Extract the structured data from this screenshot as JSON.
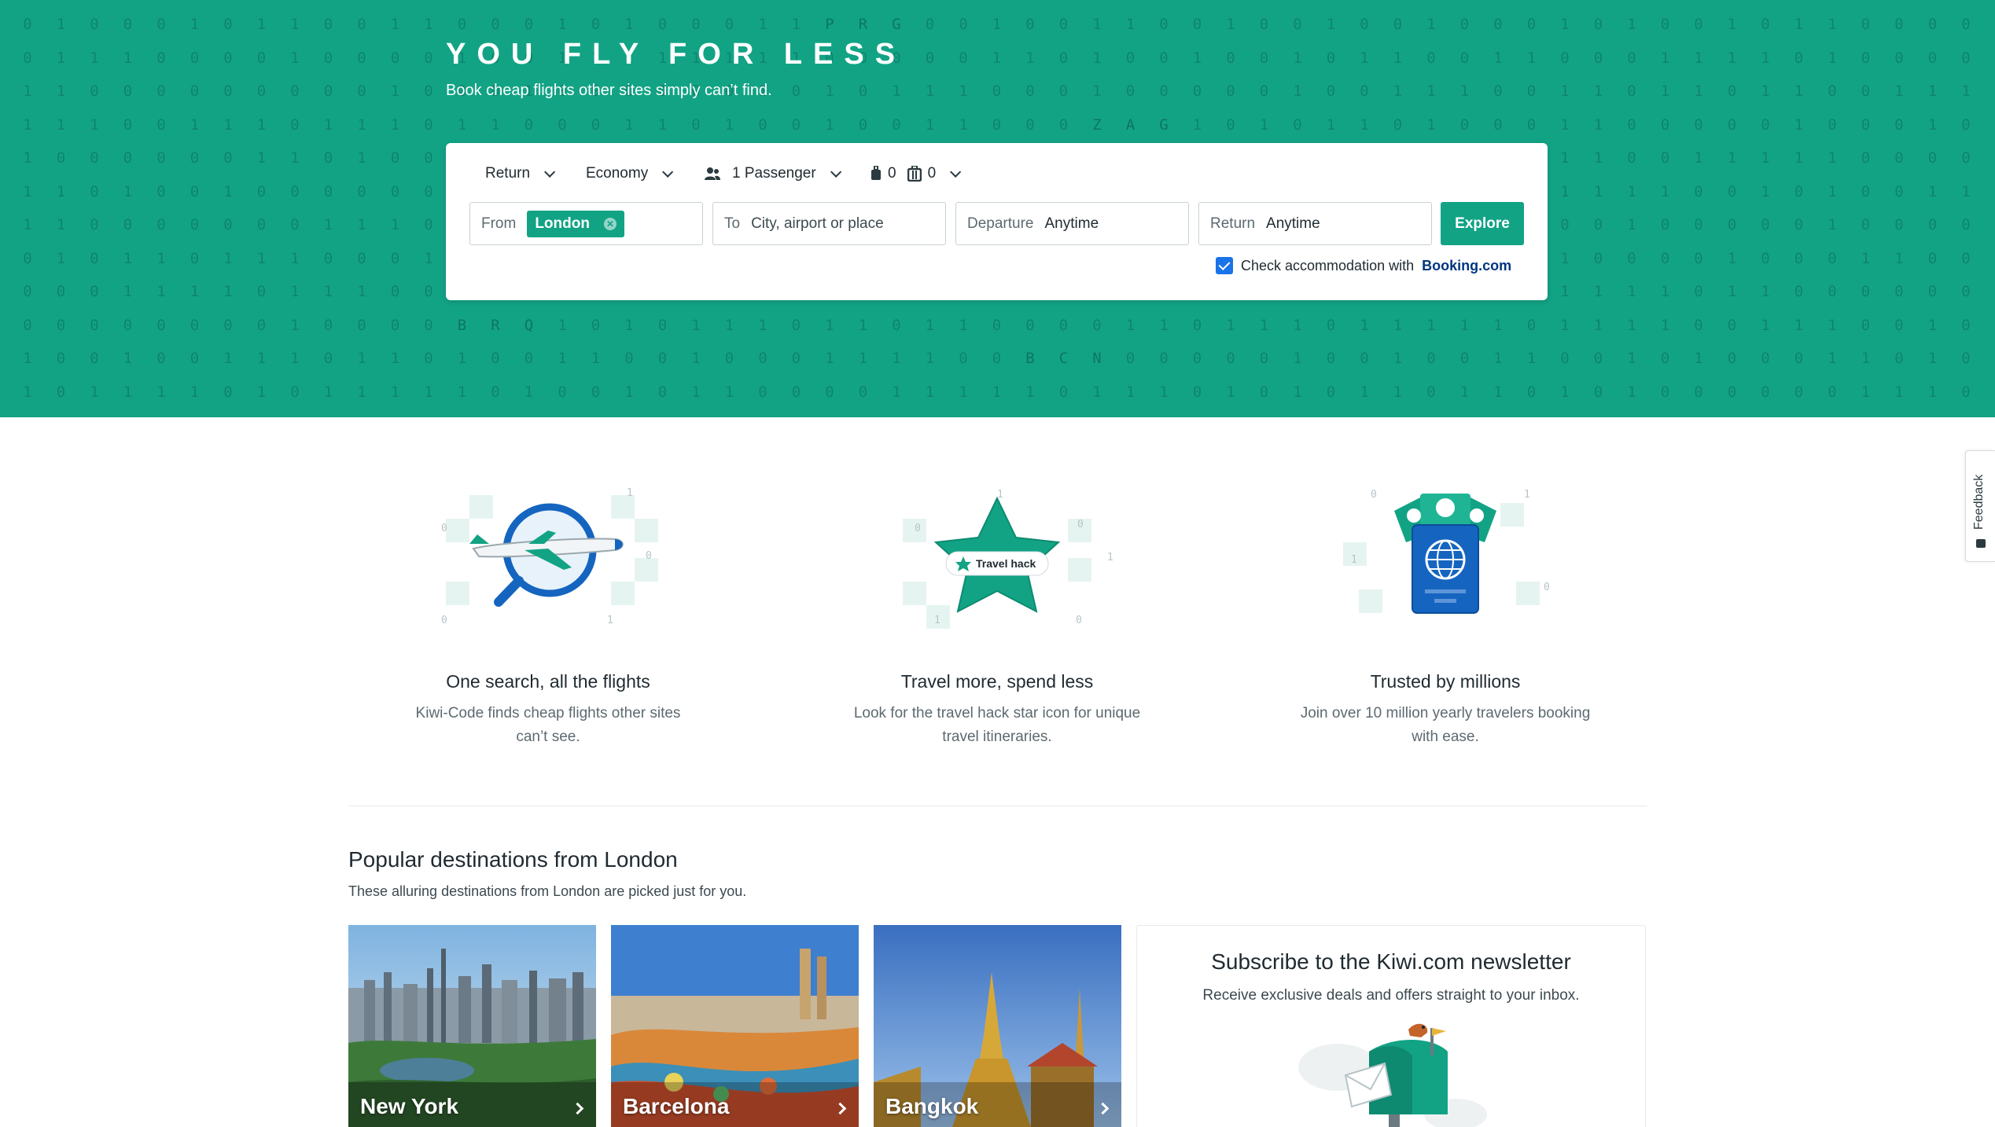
{
  "hero": {
    "title": "YOU FLY FOR LESS",
    "subtitle": "Book cheap flights other sites simply can’t find.",
    "background_color": "#12a385",
    "airport_codes": [
      "PRG",
      "ZAG",
      "BRQ",
      "BCN"
    ]
  },
  "search": {
    "trip_type": "Return",
    "cabin_class": "Economy",
    "passengers": "1 Passenger",
    "cabin_bags": "0",
    "checked_bags": "0",
    "from_label": "From",
    "from_value": "London",
    "to_label": "To",
    "to_placeholder": "City, airport or place",
    "departure_label": "Departure",
    "departure_value": "Anytime",
    "return_label": "Return",
    "return_value": "Anytime",
    "explore_label": "Explore",
    "accommodation_text": "Check accommodation with",
    "accommodation_brand": "Booking.com",
    "accommodation_checked": true,
    "icons": [
      "passenger-icon",
      "cabin-bag-icon",
      "checked-bag-icon",
      "chevron-down-icon",
      "clear-icon",
      "checkbox-icon"
    ]
  },
  "features": [
    {
      "title": "One search, all the flights",
      "desc_line1": "Kiwi-Code finds cheap flights other sites",
      "desc_line2": "can’t see.",
      "icon": "plane-search-illustration"
    },
    {
      "title": "Travel more, spend less",
      "desc_line1": "Look for the travel hack star icon for unique",
      "desc_line2": "travel itineraries.",
      "badge": "Travel hack",
      "icon": "star-illustration"
    },
    {
      "title": "Trusted by millions",
      "desc_line1": "Join over 10 million yearly travelers booking",
      "desc_line2": "with ease.",
      "icon": "passport-illustration"
    }
  ],
  "popular": {
    "title": "Popular destinations from London",
    "subtitle": "These alluring destinations from London are picked just for you.",
    "destinations": [
      {
        "name": "New York"
      },
      {
        "name": "Barcelona"
      },
      {
        "name": "Bangkok"
      }
    ]
  },
  "newsletter": {
    "title": "Subscribe to the Kiwi.com newsletter",
    "subtitle": "Receive exclusive deals and offers straight to your inbox."
  },
  "feedback": {
    "label": "Feedback"
  },
  "colors": {
    "brand": "#12a385",
    "checkbox": "#1a73e8",
    "booking": "#003580"
  }
}
